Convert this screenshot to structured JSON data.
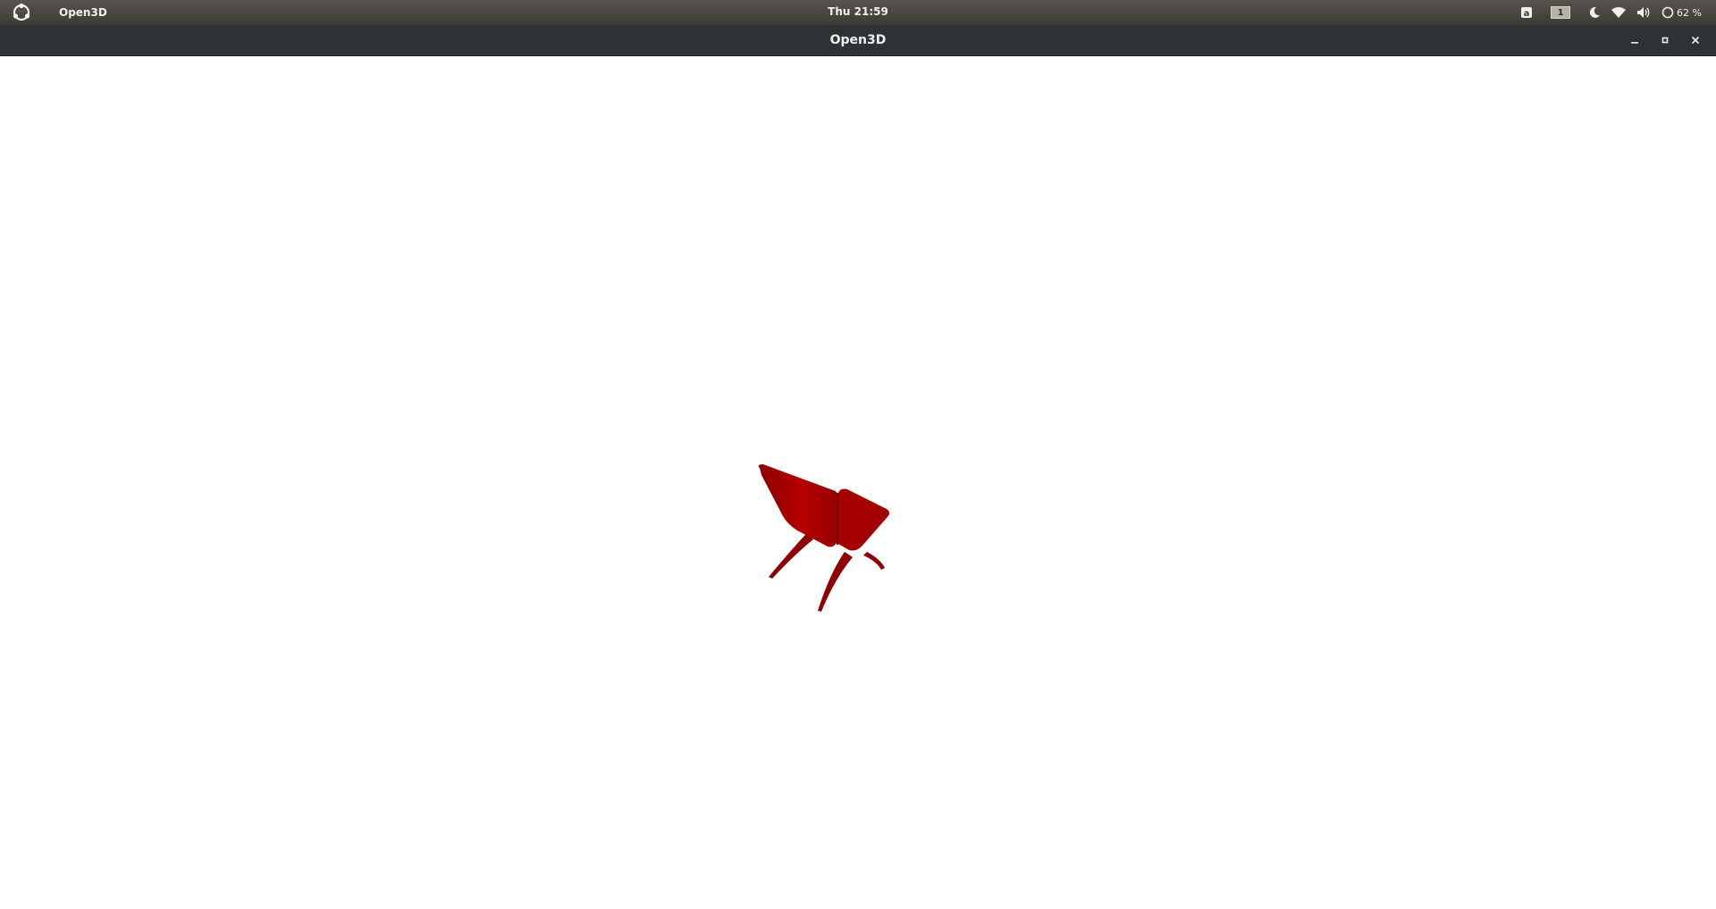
{
  "topbar": {
    "activities_icon": "ubuntu-budgie-logo-icon",
    "app_menu_label": "Open3D",
    "clock": "Thu 21:59",
    "tray": {
      "keyboard_indicator": "a",
      "workspace_number": "1",
      "night_light_icon": "moon-icon",
      "network_icon": "wifi-icon",
      "volume_icon": "speaker-icon",
      "battery_icon": "battery-ring-icon",
      "battery_percent": "62 %"
    }
  },
  "window": {
    "title": "Open3D",
    "controls": {
      "minimize_icon": "minimize-icon",
      "maximize_icon": "maximize-icon",
      "close_icon": "close-icon"
    }
  },
  "viewport": {
    "background_color": "#ffffff",
    "model": {
      "object": "chair-mesh",
      "color": "#a80000"
    }
  }
}
